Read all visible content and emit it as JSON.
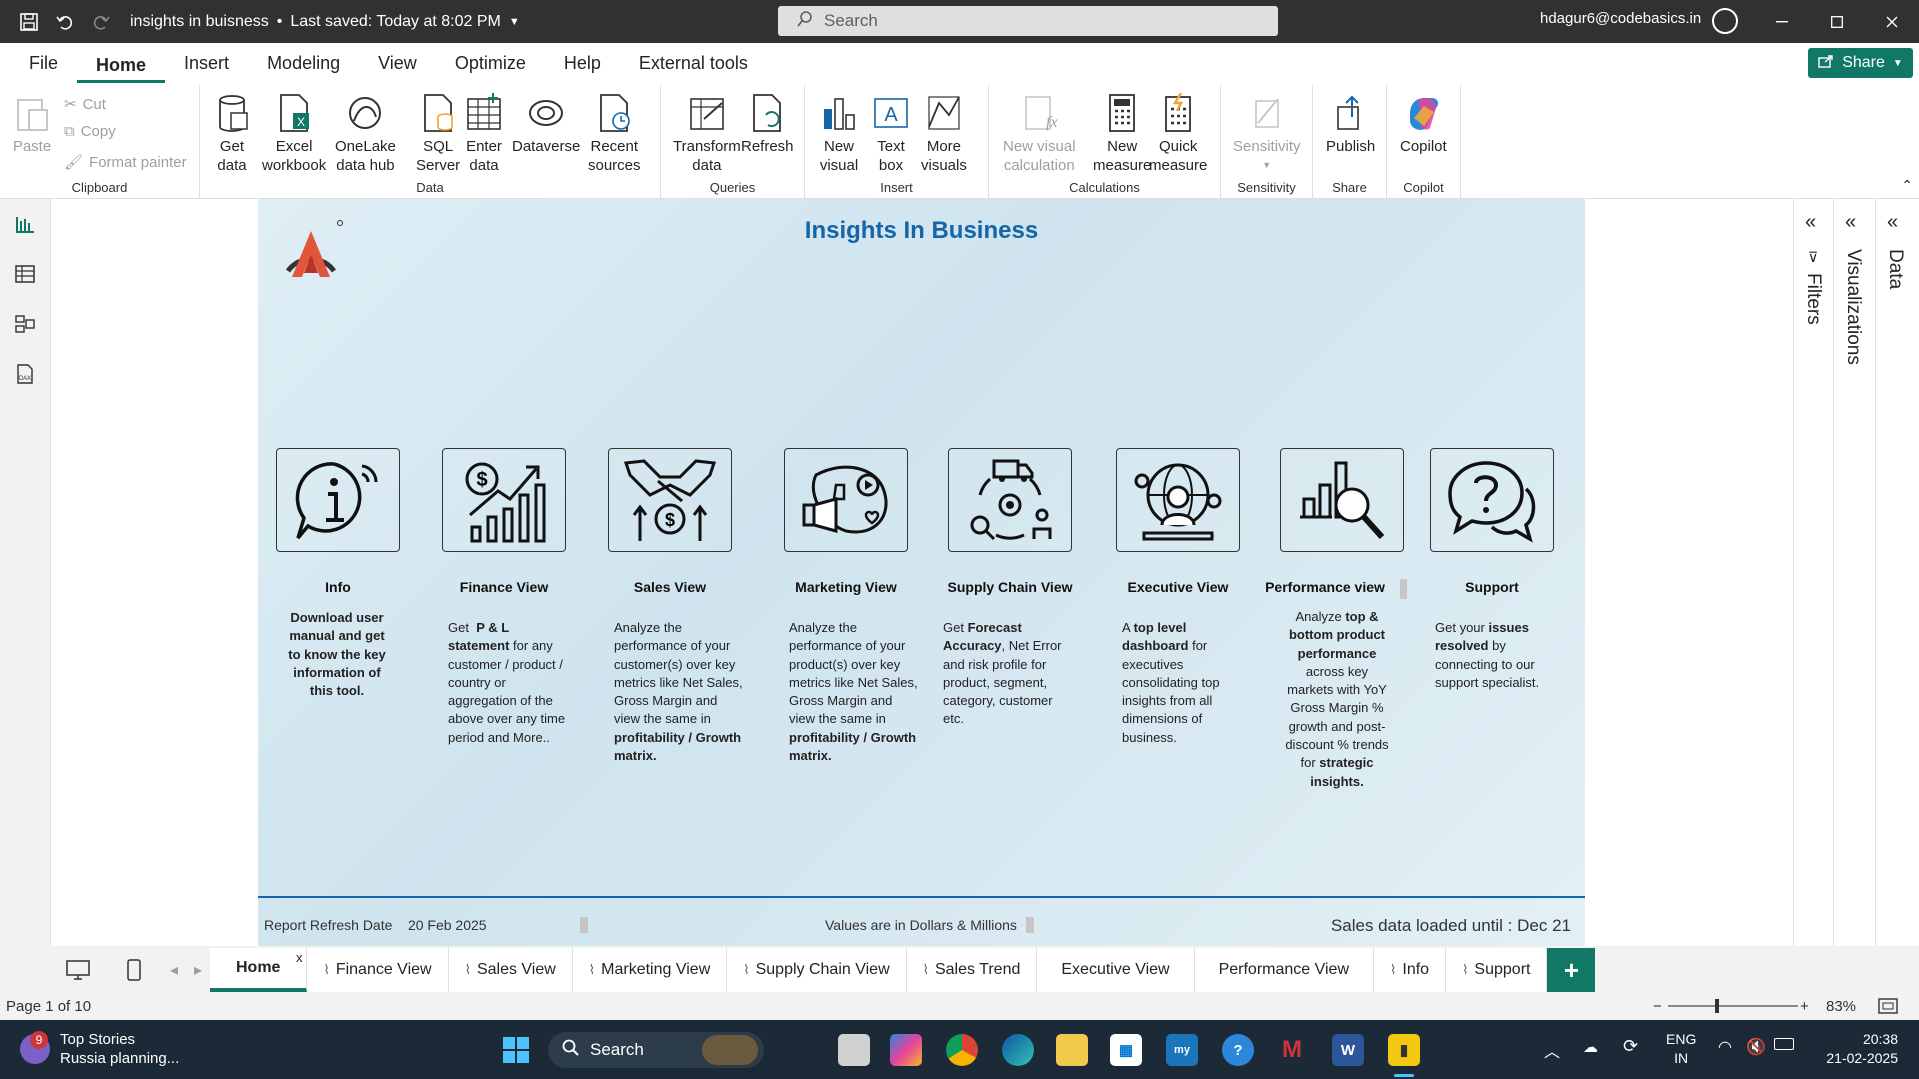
{
  "titlebar": {
    "title": "insights in buisness",
    "saved": "Last saved: Today at 8:02 PM",
    "search_placeholder": "Search",
    "user": "hdagur6@codebasics.in"
  },
  "menu": {
    "items": [
      "File",
      "Home",
      "Insert",
      "Modeling",
      "View",
      "Optimize",
      "Help",
      "External tools"
    ],
    "active": "Home",
    "share_label": "Share"
  },
  "ribbon": {
    "clipboard": {
      "paste": "Paste",
      "cut": "Cut",
      "copy": "Copy",
      "format_painter": "Format painter",
      "label": "Clipboard"
    },
    "data": {
      "get_data": "Get\ndata",
      "excel": "Excel\nworkbook",
      "onelake": "OneLake\ndata hub",
      "sql": "SQL\nServer",
      "enter": "Enter\ndata",
      "dataverse": "Dataverse",
      "recent": "Recent\nsources",
      "label": "Data"
    },
    "queries": {
      "transform": "Transform\ndata",
      "refresh": "Refresh",
      "label": "Queries"
    },
    "insert": {
      "new_visual": "New\nvisual",
      "text_box": "Text\nbox",
      "more_visuals": "More\nvisuals",
      "label": "Insert"
    },
    "calculations": {
      "new_visual_calc": "New visual\ncalculation",
      "new_measure": "New\nmeasure",
      "quick_measure": "Quick\nmeasure",
      "label": "Calculations"
    },
    "sensitivity": {
      "sensitivity": "Sensitivity",
      "label": "Sensitivity"
    },
    "share": {
      "publish": "Publish",
      "label": "Share"
    },
    "copilot": {
      "copilot": "Copilot",
      "label": "Copilot"
    }
  },
  "report": {
    "title": "Insights In Business",
    "cards": [
      {
        "title": "Info",
        "desc_html": "Download <b>user manual</b> and get to know the key information of this tool."
      },
      {
        "title": "Finance View",
        "desc_html": "Get &nbsp;<b>P &amp; L statement</b> for any customer / product / country or aggregation of the above over any time period and More.."
      },
      {
        "title": "Sales View",
        "desc_html": "Analyze the performance of your customer(s) over key metrics like Net Sales, Gross Margin and view the same in <b>profitability / Growth matrix.</b>"
      },
      {
        "title": "Marketing View",
        "desc_html": "Analyze the performance of your product(s) over key metrics like Net Sales, Gross Margin and view the same in <b>profitability / Growth matrix.</b>"
      },
      {
        "title": "Supply Chain View",
        "desc_html": "Get <b>Forecast Accuracy</b>, Net Error and risk profile for product, segment, category, customer etc."
      },
      {
        "title": "Executive View",
        "desc_html": "A <b>top level dashboard</b> for executives consolidating top insights from all dimensions of business."
      },
      {
        "title": "Performance view",
        "desc_html": "Analyze <b>top &amp; bottom product performance</b> across key markets with YoY Gross Margin % growth and post-discount % trends for <b>strategic insights.</b>"
      },
      {
        "title": "Support",
        "desc_html": "Get your <b>issues resolved</b> by connecting to our support specialist."
      }
    ],
    "footer": {
      "refresh": "Report Refresh Date &nbsp;&nbsp; 20 Feb 2025",
      "values": "Values are in Dollars &amp; Millions",
      "loaded": "Sales data loaded until : Dec 21"
    }
  },
  "panes": {
    "filters": "Filters",
    "visualizations": "Visualizations",
    "data": "Data"
  },
  "tabs": [
    "Home",
    "Finance View",
    "Sales View",
    "Marketing View",
    "Supply Chain View",
    "Sales Trend",
    "Executive View",
    "Performance View",
    "Info",
    "Support"
  ],
  "status": {
    "page": "Page 1 of 10",
    "zoom": "83%"
  },
  "taskbar": {
    "news_badge": "9",
    "news_title": "Top Stories",
    "news_sub": "Russia planning...",
    "search": "Search",
    "lang1": "ENG",
    "lang2": "IN",
    "time": "20:38",
    "date": "21-02-2025"
  },
  "colors": {
    "accent": "#117865",
    "title_blue": "#1565a8"
  }
}
